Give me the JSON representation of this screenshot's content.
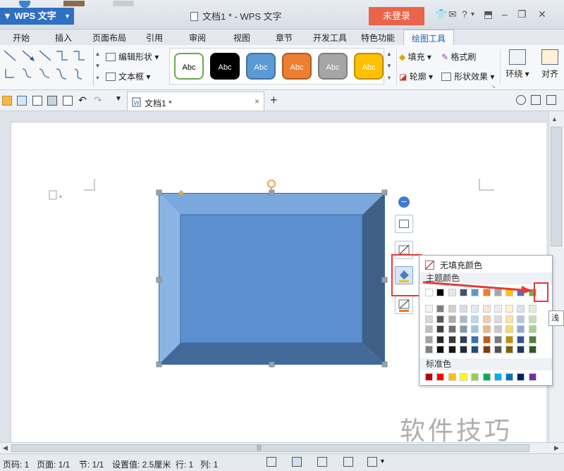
{
  "app": {
    "logo": "WPS 文字",
    "document_title": "文档1 * - WPS 文字",
    "login_button": "未登录",
    "help_glyph": "?"
  },
  "tabs": [
    "开始",
    "插入",
    "页面布局",
    "引用",
    "审阅",
    "视图",
    "章节",
    "开发工具",
    "特色功能",
    "绘图工具"
  ],
  "active_tab": "绘图工具",
  "ribbon": {
    "edit_shape": "编辑形状",
    "textbox": "文本框",
    "fill": "填充",
    "outline": "轮廓",
    "format_painter": "格式刷",
    "shape_effects": "形状效果",
    "wrap": "环绕",
    "align": "对齐",
    "style_label": "Abc",
    "style_presets": [
      {
        "fill": "#ffffff",
        "border": "#6aa84f",
        "text": "#000000"
      },
      {
        "fill": "#000000",
        "border": "#000000",
        "text": "#ffffff"
      },
      {
        "fill": "#5b9bd5",
        "border": "#41719c",
        "text": "#ffffff"
      },
      {
        "fill": "#ed7d31",
        "border": "#ae5a21",
        "text": "#ffffff"
      },
      {
        "fill": "#a5a5a5",
        "border": "#7c7c7c",
        "text": "#ffffff"
      },
      {
        "fill": "#ffc000",
        "border": "#bc8c00",
        "text": "#ffffff"
      }
    ]
  },
  "document_tab": {
    "name": "文档1 *",
    "close": "×",
    "add": "+"
  },
  "color_picker": {
    "no_fill": "无填充颜色",
    "theme_colors_title": "主题颜色",
    "standard_colors_title": "标准色",
    "theme_top_row": [
      "#ffffff",
      "#000000",
      "#e7e6e6",
      "#44546a",
      "#5b9bd5",
      "#ed7d31",
      "#a5a5a5",
      "#ffc000",
      "#4472c4",
      "#70ad47"
    ],
    "theme_shades": [
      [
        "#f2f2f2",
        "#7f7f7f",
        "#d0cece",
        "#d6dce4",
        "#deebf6",
        "#fbe5d5",
        "#ededed",
        "#fff2cc",
        "#d9e2f3",
        "#e2efd9"
      ],
      [
        "#d8d8d8",
        "#595959",
        "#aeabab",
        "#adb9ca",
        "#bdd7ee",
        "#f7cbac",
        "#dbdbdb",
        "#fee599",
        "#b4c6e7",
        "#c5e0b3"
      ],
      [
        "#bfbfbf",
        "#3f3f3f",
        "#757070",
        "#8496b0",
        "#9dc3e6",
        "#f4b183",
        "#c9c9c9",
        "#ffd965",
        "#8eaadb",
        "#a8d08d"
      ],
      [
        "#a5a5a5",
        "#262626",
        "#3a3838",
        "#323f4f",
        "#2e75b5",
        "#c55a11",
        "#7b7b7b",
        "#bf9000",
        "#2f5496",
        "#538135"
      ],
      [
        "#7f7f7f",
        "#0c0c0c",
        "#171616",
        "#222a35",
        "#1e4e79",
        "#833c0b",
        "#525252",
        "#7f6000",
        "#1f3763",
        "#375623"
      ]
    ],
    "standard": [
      "#c00000",
      "#ff0000",
      "#ffc000",
      "#ffff00",
      "#92d050",
      "#00b050",
      "#00b0f0",
      "#0070c0",
      "#002060",
      "#7030a0"
    ],
    "highlight_color": "#e53935",
    "tooltip": "浅绿"
  },
  "shape": {
    "face": "#5b8fd0",
    "top_bevel": "#7aa7dc",
    "left_bevel": "#8ab4e3",
    "right_bevel": "#3f5f86",
    "bottom_bevel": "#42699a",
    "outline": "#3a6aa6"
  },
  "status_bar": {
    "page_num": "页码: 1",
    "pages": "页面: 1/1",
    "section": "节: 1/1",
    "setting": "设置值: 2.5厘米",
    "row": "行: 1",
    "col": "列: 1"
  },
  "watermark": "软件技巧"
}
